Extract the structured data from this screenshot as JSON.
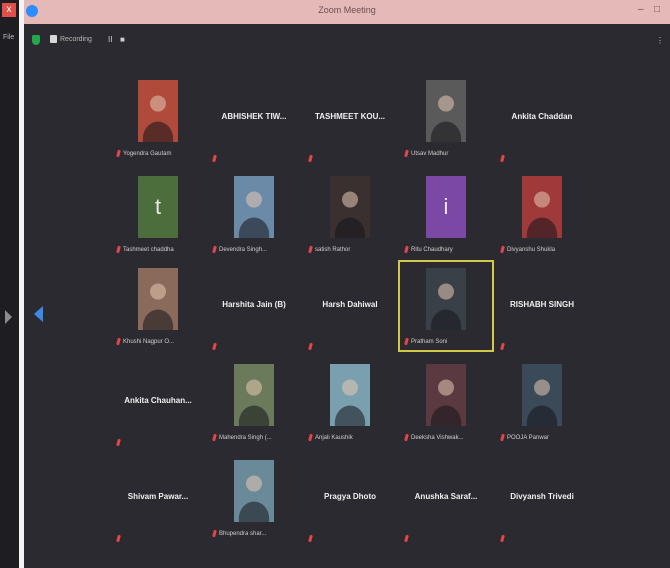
{
  "app": {
    "title": "Zoom Meeting",
    "close_btn": "x",
    "left_file": "File"
  },
  "window_controls": {
    "minimize": "–",
    "maximize": "□"
  },
  "toolbar": {
    "recording_label": "Recording",
    "pause": "II",
    "stop": "■",
    "menu": "⋮"
  },
  "colors": {
    "highlight": "#d2c94a",
    "mute": "#e04848",
    "zoom_blue": "#2d8cff",
    "shield": "#22a84a"
  },
  "participants": [
    {
      "name": "",
      "caption": "Yogendra Gautam",
      "video": true,
      "color": "#b04a3a"
    },
    {
      "name": "ABHISHEK TIW...",
      "caption": "",
      "video": false
    },
    {
      "name": "TASHMEET KOU...",
      "caption": "",
      "video": false
    },
    {
      "name": "",
      "caption": "Utsav Madhur",
      "video": true,
      "color": "#5a5a5a"
    },
    {
      "name": "Ankita Chaddan",
      "caption": "",
      "video": false
    },
    {
      "name": "",
      "caption": "Tashmeet chaddha",
      "video": true,
      "initial": "t",
      "color": "#4c6e3c"
    },
    {
      "name": "",
      "caption": "Devendra Singh...",
      "video": true,
      "color": "#6a8aa8"
    },
    {
      "name": "",
      "caption": "satish Rathor",
      "video": true,
      "color": "#3a3030"
    },
    {
      "name": "",
      "caption": "Ritu Chaudhary",
      "video": true,
      "initial": "i",
      "color": "#7b48a6"
    },
    {
      "name": "",
      "caption": "Divyanshu Shukla",
      "video": true,
      "color": "#a03a3a"
    },
    {
      "name": "",
      "caption": "Khushi Nagpur O...",
      "video": true,
      "color": "#8a6a5a"
    },
    {
      "name": "Harshita Jain (B)",
      "caption": "",
      "video": false
    },
    {
      "name": "Harsh Dahiwal",
      "caption": "",
      "video": false
    },
    {
      "name": "",
      "caption": "Pratham Soni",
      "video": true,
      "color": "#3a4048",
      "highlight": true
    },
    {
      "name": "RISHABH SINGH",
      "caption": "",
      "video": false
    },
    {
      "name": "Ankita Chauhan...",
      "caption": "",
      "video": false
    },
    {
      "name": "",
      "caption": "Mahendra Singh (...",
      "video": true,
      "color": "#6a7a5a"
    },
    {
      "name": "",
      "caption": "Anjali Kaushik",
      "video": true,
      "color": "#7aa0b0"
    },
    {
      "name": "",
      "caption": "Deeksha Vishwak...",
      "video": true,
      "color": "#5a3a40"
    },
    {
      "name": "",
      "caption": "POOJA Panwar",
      "video": true,
      "color": "#3a4a58"
    },
    {
      "name": "Shivam Pawar...",
      "caption": "",
      "video": false
    },
    {
      "name": "",
      "caption": "Bhupendra shar...",
      "video": true,
      "color": "#6a8a9a"
    },
    {
      "name": "Pragya Dhoto",
      "caption": "",
      "video": false
    },
    {
      "name": "Anushka Saraf...",
      "caption": "",
      "video": false
    },
    {
      "name": "Divyansh Trivedi",
      "caption": "",
      "video": false
    }
  ]
}
